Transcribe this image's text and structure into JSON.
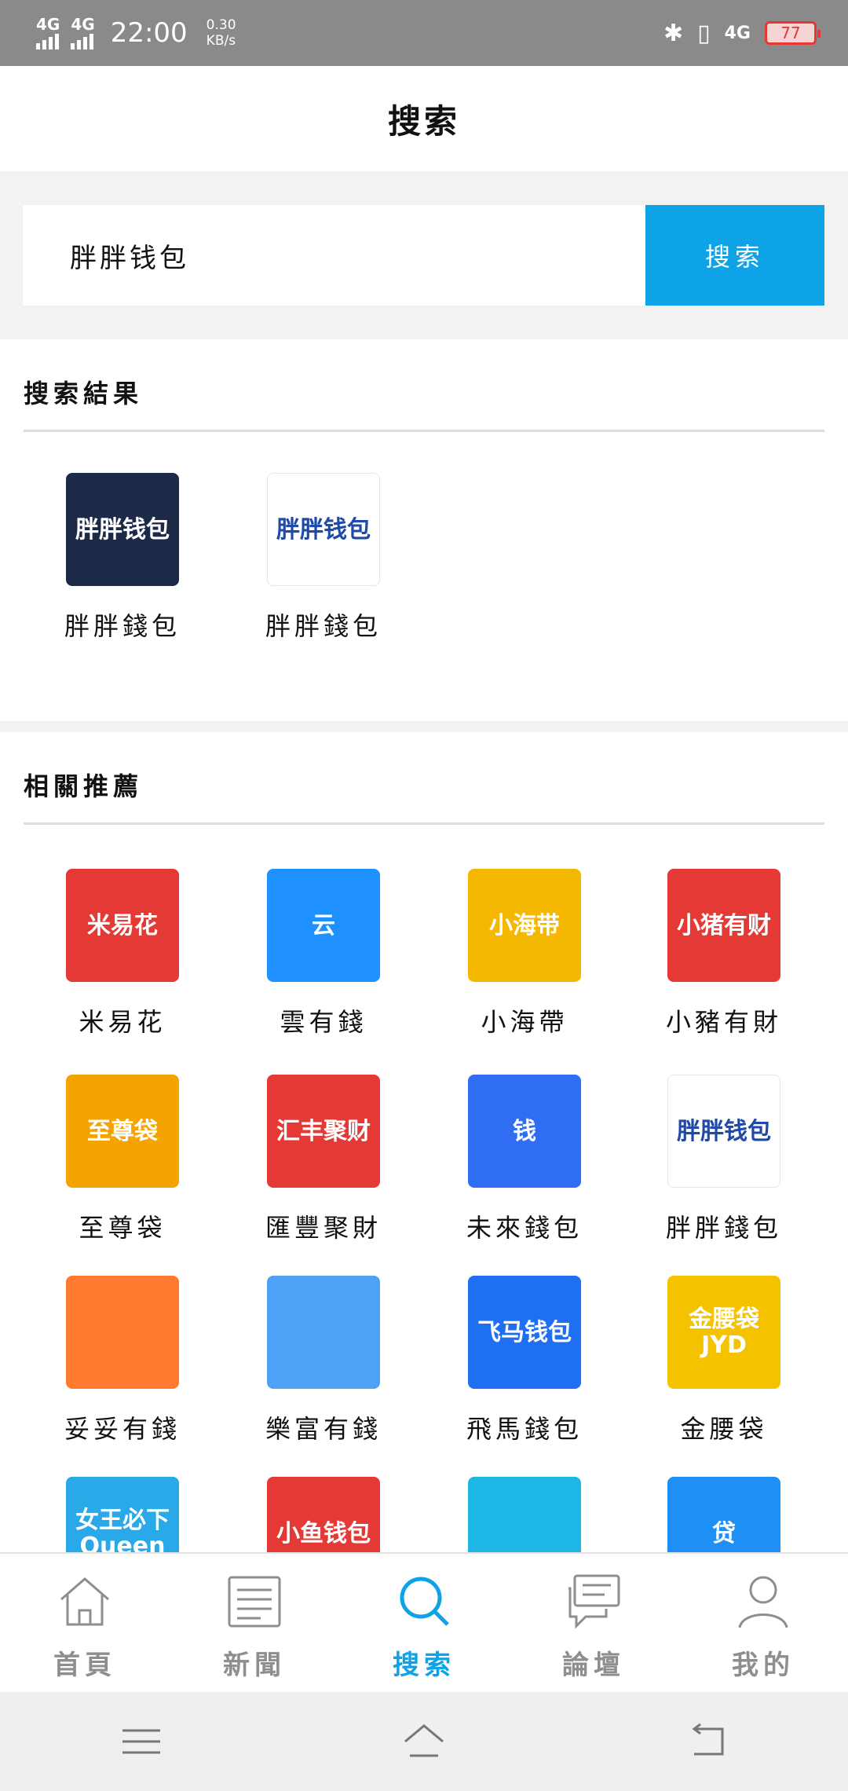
{
  "status_bar": {
    "signal1": "4G",
    "signal2": "4G",
    "time": "22:00",
    "speed_value": "0.30",
    "speed_unit": "KB/s",
    "network": "4G",
    "battery": "77"
  },
  "header": {
    "title": "搜索"
  },
  "search": {
    "query": "胖胖钱包",
    "button_label": "搜索"
  },
  "results": {
    "heading": "搜索結果",
    "items": [
      {
        "name": "胖胖錢包",
        "icon": "fat-pig-wallet-icon",
        "icon_text": "胖胖钱包",
        "color": "#1c2a47"
      },
      {
        "name": "胖胖錢包",
        "icon": "fat-wallet-logo-icon",
        "icon_text": "胖胖钱包",
        "color": "#ffffff"
      }
    ]
  },
  "related": {
    "heading": "相關推薦",
    "items": [
      {
        "name": "米易花",
        "icon": "flower-icon",
        "icon_text": "米易花",
        "color": "#e53935"
      },
      {
        "name": "雲有錢",
        "icon": "cloud-icon",
        "icon_text": "云",
        "color": "#1e90ff"
      },
      {
        "name": "小海帶",
        "icon": "seaweed-icon",
        "icon_text": "小海带",
        "color": "#f5b800"
      },
      {
        "name": "小豬有財",
        "icon": "pig-icon",
        "icon_text": "小猪有财",
        "color": "#e53935"
      },
      {
        "name": "至尊袋",
        "icon": "fortune-god-icon",
        "icon_text": "至尊袋",
        "color": "#f5a300"
      },
      {
        "name": "匯豐聚財",
        "icon": "huifeng-icon",
        "icon_text": "汇丰聚财",
        "color": "#e53935"
      },
      {
        "name": "未來錢包",
        "icon": "qian-icon",
        "icon_text": "钱",
        "color": "#2f6ef2"
      },
      {
        "name": "胖胖錢包",
        "icon": "fat-wallet-logo-icon",
        "icon_text": "胖胖钱包",
        "color": "#ffffff"
      },
      {
        "name": "妥妥有錢",
        "icon": "hand-icon",
        "icon_text": "",
        "color": "#ff7a2e"
      },
      {
        "name": "樂富有錢",
        "icon": "coin-icon",
        "icon_text": "",
        "color": "#4ea3f7"
      },
      {
        "name": "飛馬錢包",
        "icon": "horse-icon",
        "icon_text": "飞马钱包",
        "color": "#1f6ff2"
      },
      {
        "name": "金腰袋",
        "icon": "belt-icon",
        "icon_text": "金腰袋 JYD",
        "color": "#f5c200"
      },
      {
        "name": "",
        "icon": "queen-icon",
        "icon_text": "女王必下 Queen",
        "color": "#29a9e8"
      },
      {
        "name": "",
        "icon": "fish-icon",
        "icon_text": "小鱼钱包",
        "color": "#e53935"
      },
      {
        "name": "",
        "icon": "app-icon",
        "icon_text": "",
        "color": "#1fb8e6"
      },
      {
        "name": "",
        "icon": "dai-icon",
        "icon_text": "贷",
        "color": "#1e8ff5"
      }
    ]
  },
  "bottom_nav": [
    {
      "label": "首頁",
      "icon": "home-icon"
    },
    {
      "label": "新聞",
      "icon": "news-icon"
    },
    {
      "label": "搜索",
      "icon": "search-icon"
    },
    {
      "label": "論壇",
      "icon": "forum-icon"
    },
    {
      "label": "我的",
      "icon": "user-icon"
    }
  ],
  "colors": {
    "accent": "#0ea3e6",
    "inactive": "#8e8e8e"
  }
}
